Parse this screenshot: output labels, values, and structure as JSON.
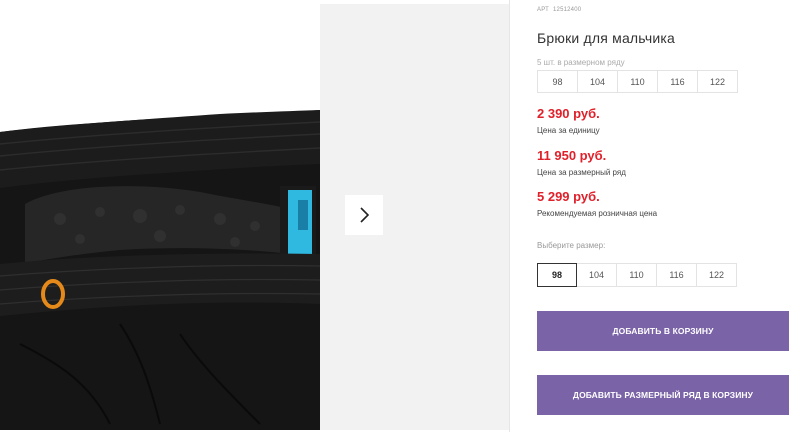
{
  "product": {
    "art_label": "АРТ",
    "art_number": "12512400",
    "title": "Брюки для мальчика"
  },
  "pack": {
    "note": "5 шт. в размерном ряду",
    "sizes": [
      "98",
      "104",
      "110",
      "116",
      "122"
    ]
  },
  "prices": [
    {
      "value": "2 390 руб.",
      "label": "Цена за единицу"
    },
    {
      "value": "11 950 руб.",
      "label": "Цена за размерный ряд"
    },
    {
      "value": "5 299 руб.",
      "label": "Рекомендуемая розничная цена"
    }
  ],
  "size_picker": {
    "label": "Выберите размер:",
    "sizes": [
      "98",
      "104",
      "110",
      "116",
      "122"
    ],
    "selected": "98"
  },
  "actions": {
    "add_to_cart": "ДОБАВИТЬ В КОРЗИНУ",
    "add_pack_to_cart": "ДОБАВИТЬ РАЗМЕРНЫЙ РЯД В КОРЗИНУ"
  },
  "colors": {
    "price": "#e0202a",
    "button": "#7a63a7"
  },
  "icons": {
    "gallery_next": "chevron-right-icon"
  }
}
